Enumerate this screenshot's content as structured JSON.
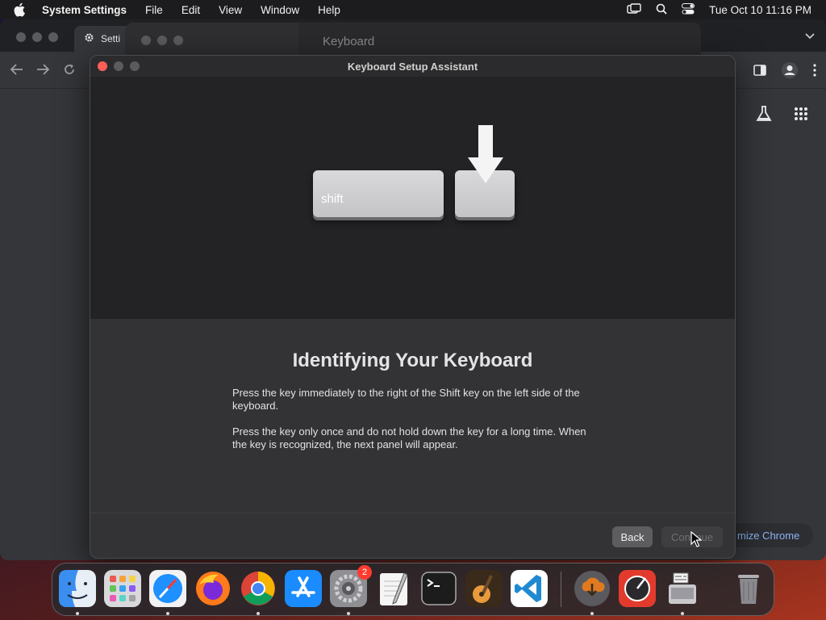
{
  "menubar": {
    "app_name": "System Settings",
    "items": [
      "File",
      "Edit",
      "View",
      "Window",
      "Help"
    ],
    "clock": "Tue Oct 10  11:16 PM"
  },
  "chrome": {
    "tab_label": "Setti",
    "customize_label": "mize Chrome"
  },
  "settings": {
    "title": "Keyboard"
  },
  "dialog": {
    "title": "Keyboard Setup Assistant",
    "shift_key_label": "shift",
    "heading": "Identifying Your Keyboard",
    "paragraph1": "Press the key immediately to the right of the Shift key on the left side of the keyboard.",
    "paragraph2": "Press the key only once and do not hold down the key for a long time. When the key is recognized, the next panel will appear.",
    "back_label": "Back",
    "continue_label": "Continue"
  },
  "dock": {
    "apps": [
      {
        "name": "Finder",
        "icon": "finder-icon",
        "color": "#3a8ef0"
      },
      {
        "name": "Launchpad",
        "icon": "launchpad-icon",
        "color": "#d9d9dc"
      },
      {
        "name": "Safari",
        "icon": "safari-icon",
        "color": "#1e90ff"
      },
      {
        "name": "Firefox",
        "icon": "firefox-icon",
        "color": "#ff7a1a"
      },
      {
        "name": "Chrome",
        "icon": "chrome-icon",
        "color": "#ffffff"
      },
      {
        "name": "App Store",
        "icon": "app-store-icon",
        "color": "#1a8cff"
      },
      {
        "name": "System Settings",
        "icon": "system-settings-icon",
        "color": "#8e8e93",
        "badge": "2"
      },
      {
        "name": "TextEdit",
        "icon": "textedit-icon",
        "color": "#f5f5f5"
      },
      {
        "name": "Terminal",
        "icon": "terminal-icon",
        "color": "#1c1c1c"
      },
      {
        "name": "GarageBand",
        "icon": "garageband-icon",
        "color": "#3a2a1a"
      },
      {
        "name": "VS Code",
        "icon": "vscode-icon",
        "color": "#ffffff"
      },
      {
        "name": "Downloads",
        "icon": "downloads-icon",
        "color": "#e07a20"
      },
      {
        "name": "Instruments",
        "icon": "instruments-icon",
        "color": "#e23b2e"
      },
      {
        "name": "Boot Camp Assistant",
        "icon": "disk-utility-icon",
        "color": "#c9c9cc"
      },
      {
        "name": "Trash",
        "icon": "trash-icon",
        "color": "#8a8a8e"
      }
    ]
  }
}
